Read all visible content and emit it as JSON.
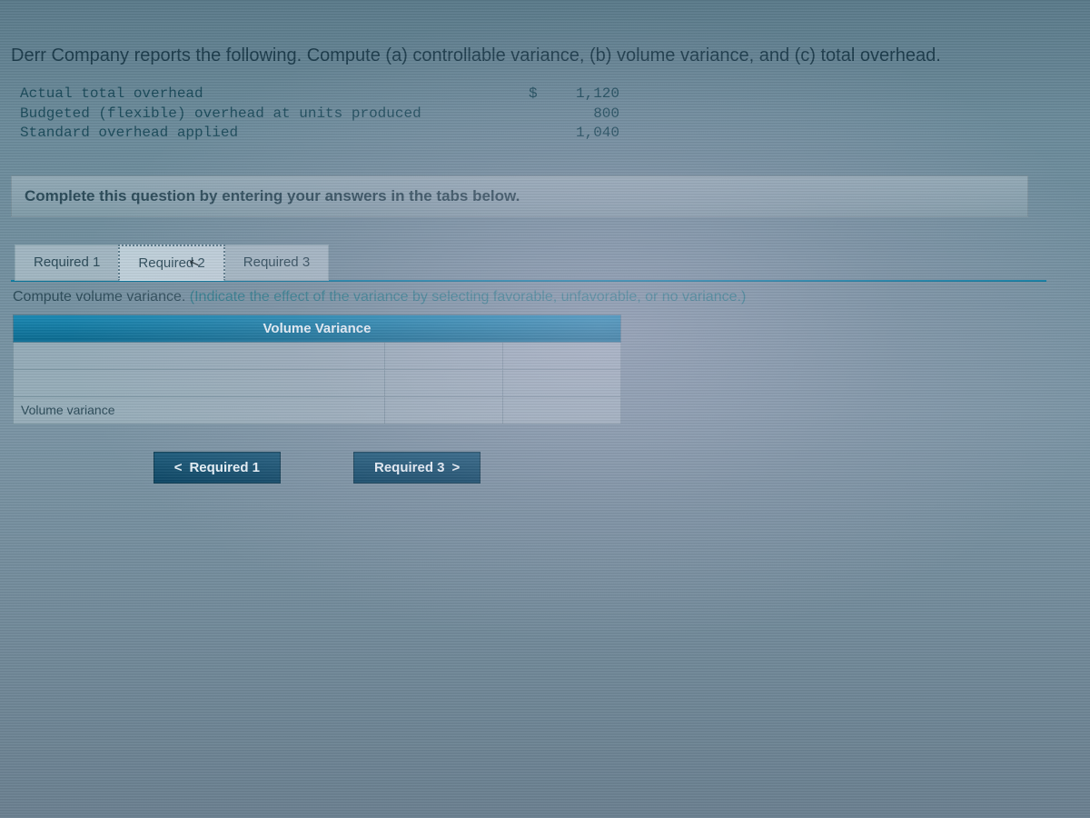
{
  "question": "Derr Company reports the following. Compute (a) controllable variance, (b) volume variance, and (c) total overhead.",
  "data_rows": [
    {
      "label": "Actual total overhead",
      "dollar": "$",
      "value": "1,120"
    },
    {
      "label": "Budgeted (flexible) overhead at units produced",
      "dollar": "",
      "value": "800"
    },
    {
      "label": "Standard overhead applied",
      "dollar": "",
      "value": "1,040"
    }
  ],
  "instruction": "Complete this question by entering your answers in the tabs below.",
  "tabs": [
    {
      "label": "Required 1",
      "active": false
    },
    {
      "label": "Required 2",
      "active": true
    },
    {
      "label": "Required 3",
      "active": false
    }
  ],
  "sub_instruction_lead": "Compute volume variance. ",
  "sub_instruction_hint": "(Indicate the effect of the variance by selecting favorable, unfavorable, or no variance.)",
  "table": {
    "header": "Volume Variance",
    "rows": [
      {
        "label": "",
        "value": "",
        "select": ""
      },
      {
        "label": "",
        "value": "",
        "select": ""
      },
      {
        "label": "Volume variance",
        "value": "",
        "select": ""
      }
    ]
  },
  "nav": {
    "prev": "Required 1",
    "next": "Required 3"
  },
  "chevrons": {
    "left": "<",
    "right": ">"
  }
}
